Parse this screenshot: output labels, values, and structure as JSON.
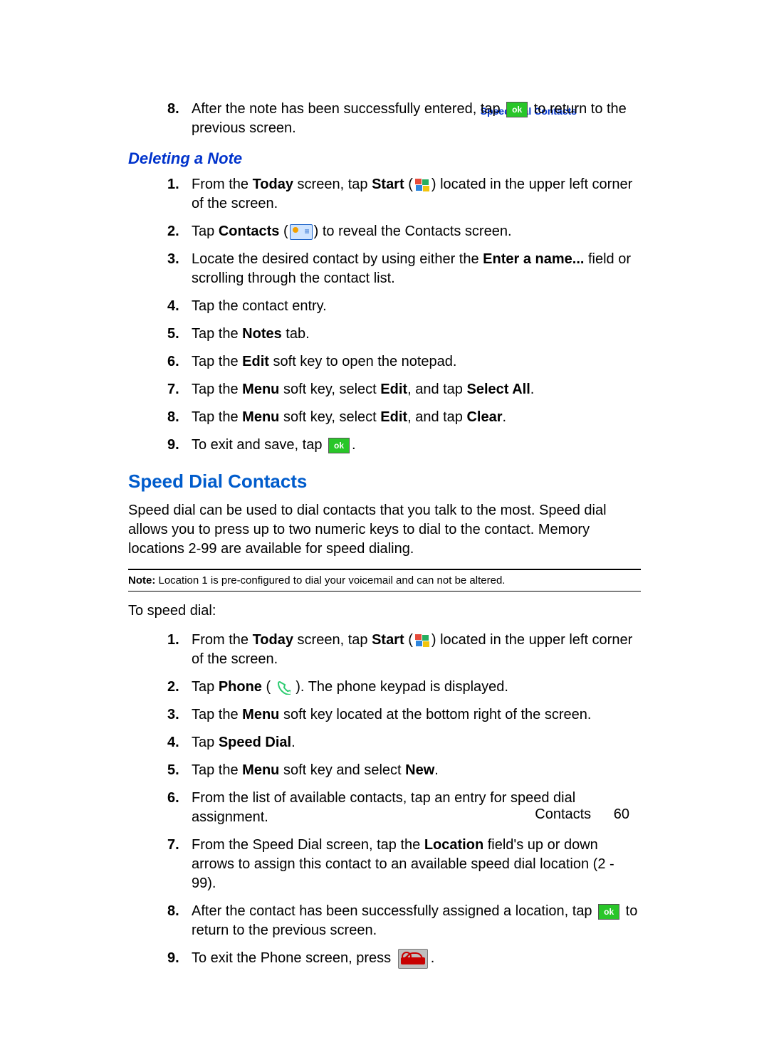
{
  "header_link": "Speed Dial Contacts",
  "prev_list_start": 8,
  "prev_list": [
    {
      "before": "After the note has been successfully entered, tap ",
      "icon": "ok",
      "after": " to return to the previous screen."
    }
  ],
  "h_deleting": "Deleting a Note",
  "del_list": [
    {
      "segments": [
        {
          "t": "From the "
        },
        {
          "b": "Today"
        },
        {
          "t": " screen, tap "
        },
        {
          "b": "Start"
        },
        {
          "t": " ("
        },
        {
          "icon": "start"
        },
        {
          "t": ") located in the upper left corner of the screen."
        }
      ]
    },
    {
      "segments": [
        {
          "t": "Tap "
        },
        {
          "b": "Contacts"
        },
        {
          "t": " ("
        },
        {
          "icon": "contacts"
        },
        {
          "t": ") to reveal the Contacts screen."
        }
      ]
    },
    {
      "segments": [
        {
          "t": "Locate the desired contact by using either the "
        },
        {
          "b": "Enter a name..."
        },
        {
          "t": " field or scrolling through the contact list."
        }
      ]
    },
    {
      "segments": [
        {
          "t": "Tap the contact entry."
        }
      ]
    },
    {
      "segments": [
        {
          "t": "Tap the "
        },
        {
          "b": "Notes"
        },
        {
          "t": " tab."
        }
      ]
    },
    {
      "segments": [
        {
          "t": "Tap the "
        },
        {
          "b": "Edit"
        },
        {
          "t": " soft key to open the notepad."
        }
      ]
    },
    {
      "segments": [
        {
          "t": "Tap the "
        },
        {
          "b": "Menu"
        },
        {
          "t": " soft key, select "
        },
        {
          "b": "Edit"
        },
        {
          "t": ", and tap "
        },
        {
          "b": "Select All"
        },
        {
          "t": "."
        }
      ]
    },
    {
      "segments": [
        {
          "t": "Tap the "
        },
        {
          "b": "Menu"
        },
        {
          "t": " soft key, select "
        },
        {
          "b": "Edit"
        },
        {
          "t": ", and tap "
        },
        {
          "b": "Clear"
        },
        {
          "t": "."
        }
      ]
    },
    {
      "segments": [
        {
          "t": "To exit and save, tap "
        },
        {
          "icon": "ok"
        },
        {
          "t": "."
        }
      ]
    }
  ],
  "h_speed": "Speed Dial Contacts",
  "speed_intro": "Speed dial can be used to dial contacts that you talk to the most. Speed dial allows you to press up to two numeric keys to dial to the contact. Memory locations 2-99 are available for speed dialing.",
  "note_label": "Note:",
  "note_text": " Location 1 is pre-configured to dial your voicemail and can not be altered.",
  "to_speed": "To speed dial:",
  "sd_list": [
    {
      "segments": [
        {
          "t": "From the "
        },
        {
          "b": "Today"
        },
        {
          "t": " screen, tap "
        },
        {
          "b": "Start"
        },
        {
          "t": " ("
        },
        {
          "icon": "start"
        },
        {
          "t": ") located in the upper left corner of the screen."
        }
      ]
    },
    {
      "segments": [
        {
          "t": "Tap "
        },
        {
          "b": "Phone"
        },
        {
          "t": " ( "
        },
        {
          "icon": "phone"
        },
        {
          "t": " ). The phone keypad is displayed."
        }
      ]
    },
    {
      "segments": [
        {
          "t": "Tap the "
        },
        {
          "b": "Menu"
        },
        {
          "t": " soft key located at the bottom right of the screen."
        }
      ]
    },
    {
      "segments": [
        {
          "t": "Tap "
        },
        {
          "b": "Speed Dial"
        },
        {
          "t": "."
        }
      ]
    },
    {
      "segments": [
        {
          "t": "Tap the "
        },
        {
          "b": "Menu"
        },
        {
          "t": " soft key and select "
        },
        {
          "b": "New"
        },
        {
          "t": "."
        }
      ]
    },
    {
      "segments": [
        {
          "t": "From the list of available contacts, tap an entry for speed dial assignment."
        }
      ]
    },
    {
      "segments": [
        {
          "t": "From the Speed Dial screen, tap the "
        },
        {
          "b": "Location"
        },
        {
          "t": " field's up or down arrows to assign this contact to an available speed dial location (2 - 99)."
        }
      ]
    },
    {
      "segments": [
        {
          "t": "After the contact has been successfully assigned a location, tap "
        },
        {
          "icon": "ok"
        },
        {
          "t": " to return to the previous screen."
        }
      ]
    },
    {
      "segments": [
        {
          "t": "To exit the Phone screen, press "
        },
        {
          "icon": "endcall"
        },
        {
          "t": "."
        }
      ]
    }
  ],
  "footer_section": "Contacts",
  "footer_page": "60"
}
